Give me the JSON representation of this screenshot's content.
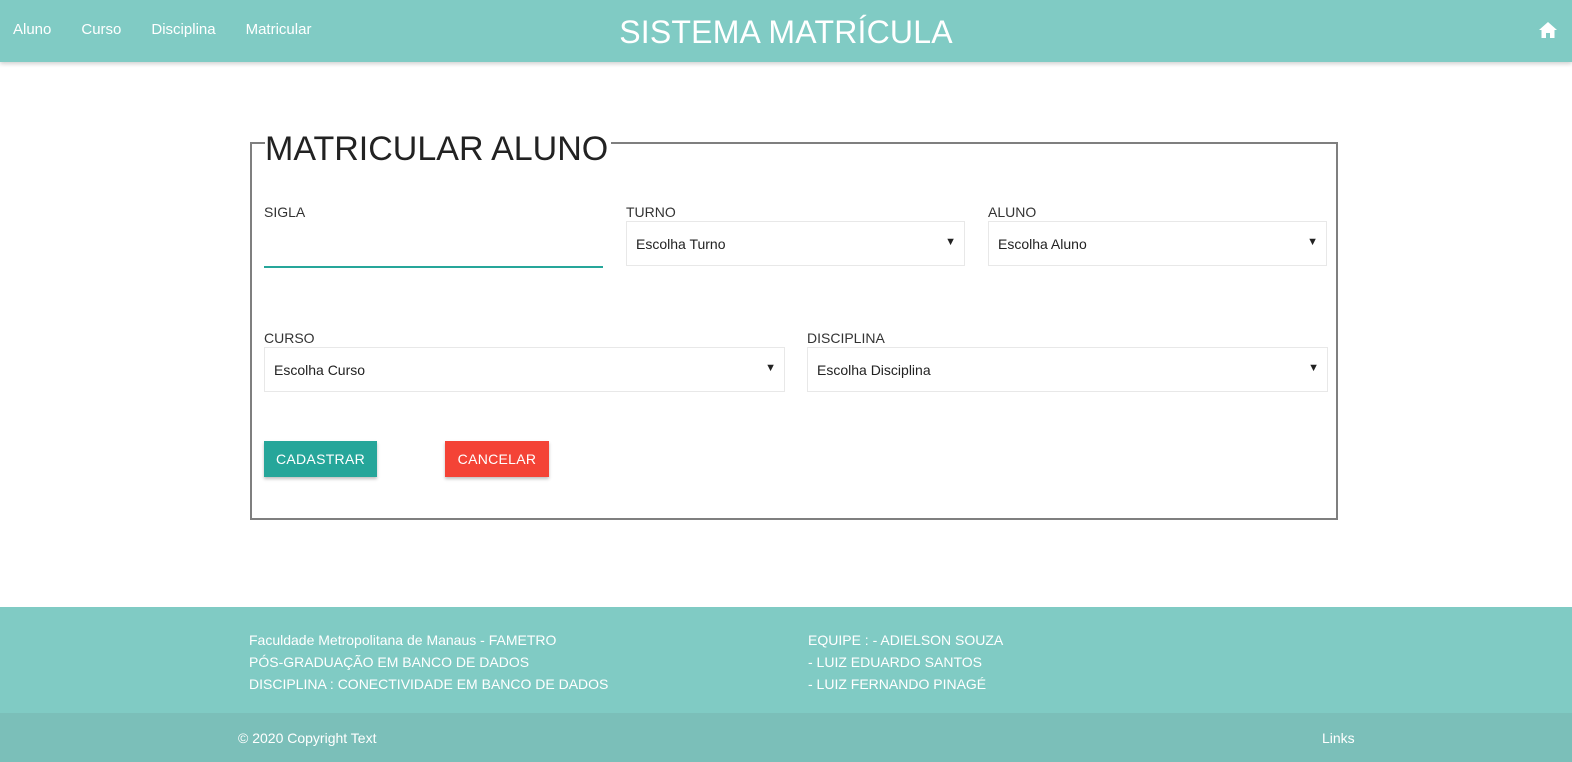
{
  "nav": {
    "links": [
      "Aluno",
      "Curso",
      "Disciplina",
      "Matricular"
    ],
    "brand": "SISTEMA MATRÍCULA",
    "home_icon": "home-icon"
  },
  "form": {
    "legend": "MATRICULAR ALUNO",
    "sigla": {
      "label": "SIGLA",
      "value": ""
    },
    "turno": {
      "label": "TURNO",
      "selected": "Escolha Turno"
    },
    "aluno": {
      "label": "ALUNO",
      "selected": "Escolha Aluno"
    },
    "curso": {
      "label": "CURSO",
      "selected": "Escolha Curso"
    },
    "disciplina": {
      "label": "DISCIPLINA",
      "selected": "Escolha Disciplina"
    },
    "caret": "▼",
    "submit_label": "CADASTRAR",
    "cancel_label": "CANCELAR"
  },
  "footer": {
    "left": [
      "Faculdade Metropolitana de Manaus - FAMETRO",
      "PÓS-GRADUAÇÃO EM BANCO DE DADOS",
      "DISCIPLINA : CONECTIVIDADE EM BANCO DE DADOS"
    ],
    "right": [
      "EQUIPE : - ADIELSON SOUZA",
      "- LUIZ EDUARDO SANTOS",
      "- LUIZ FERNANDO PINAGÉ"
    ],
    "copyright": "© 2020 Copyright Text",
    "links_label": "Links"
  },
  "colors": {
    "teal": "#80cbc4",
    "teal_dark": "#7bbfb9",
    "primary": "#26a69a",
    "danger": "#f44336"
  }
}
